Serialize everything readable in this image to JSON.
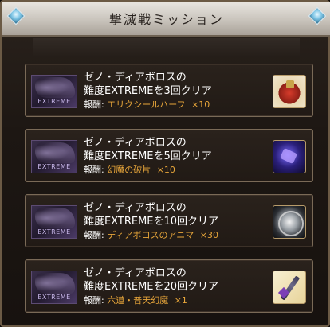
{
  "header": {
    "title": "撃滅戦ミッション"
  },
  "missions": [
    {
      "thumb_badge": "EXTREME",
      "line1": "ゼノ・ディアボロスの",
      "line2": "難度EXTREMEを3回クリア",
      "reward_label": "報酬:",
      "reward_item": "エリクシールハーフ",
      "reward_count": "×10",
      "icon": "elixir-half-icon"
    },
    {
      "thumb_badge": "EXTREME",
      "line1": "ゼノ・ディアボロスの",
      "line2": "難度EXTREMEを5回クリア",
      "reward_label": "報酬:",
      "reward_item": "幻魔の破片",
      "reward_count": "×10",
      "icon": "phantom-fragment-icon"
    },
    {
      "thumb_badge": "EXTREME",
      "line1": "ゼノ・ディアボロスの",
      "line2": "難度EXTREMEを10回クリア",
      "reward_label": "報酬:",
      "reward_item": "ディアボロスのアニマ",
      "reward_count": "×30",
      "icon": "diaboros-anima-icon"
    },
    {
      "thumb_badge": "EXTREME",
      "line1": "ゼノ・ディアボロスの",
      "line2": "難度EXTREMEを20回クリア",
      "reward_label": "報酬:",
      "reward_item": "六道・普天幻魔",
      "reward_count": "×1",
      "icon": "weapon-icon"
    }
  ],
  "colors": {
    "reward_text": "#e8a63a",
    "frame_border": "#7a6a57",
    "header_bg": "#c9c4bc"
  }
}
